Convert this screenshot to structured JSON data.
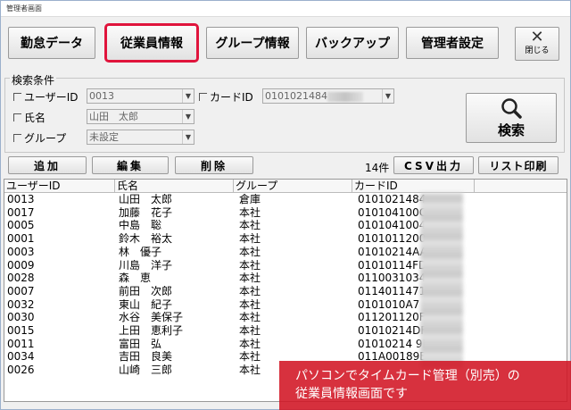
{
  "window": {
    "title": "管理者画面"
  },
  "toolbar": {
    "buttons": [
      {
        "label": "勤怠データ",
        "active": false
      },
      {
        "label": "従業員情報",
        "active": true
      },
      {
        "label": "グループ情報",
        "active": false
      },
      {
        "label": "バックアップ",
        "active": false
      },
      {
        "label": "管理者設定",
        "active": false
      }
    ],
    "close_label": "閉じる"
  },
  "search": {
    "legend": "検索条件",
    "user_id_label": "ユーザーID",
    "user_id_value": "0013",
    "card_id_label": "カードID",
    "card_id_value": "0101021484",
    "name_label": "氏名",
    "name_value": "山田　太郎",
    "group_label": "グループ",
    "group_value": "未設定",
    "search_button": "検索"
  },
  "actions": {
    "add": "追加",
    "edit": "編集",
    "delete": "削除",
    "count": "14件",
    "csv": "CSV出力",
    "print": "リスト印刷"
  },
  "table": {
    "columns": [
      "ユーザーID",
      "氏名",
      "グループ",
      "カードID"
    ],
    "rows": [
      [
        "0013",
        "山田　太郎",
        "倉庫",
        "0101021484"
      ],
      [
        "0017",
        "加藤　花子",
        "本社",
        "010104100C"
      ],
      [
        "0005",
        "中島　聡",
        "本社",
        "0101041004"
      ],
      [
        "0001",
        "鈴木　裕太",
        "本社",
        "0101011200"
      ],
      [
        "0003",
        "林　優子",
        "本社",
        "01010214AA"
      ],
      [
        "0009",
        "川島　洋子",
        "本社",
        "01010114FD"
      ],
      [
        "0028",
        "森　恵",
        "本社",
        "0110031034"
      ],
      [
        "0007",
        "前田　次郎",
        "本社",
        "0114011471"
      ],
      [
        "0032",
        "東山　紀子",
        "本社",
        "0101010A7"
      ],
      [
        "0030",
        "水谷　美保子",
        "本社",
        "011201120F"
      ],
      [
        "0015",
        "上田　恵利子",
        "本社",
        "01010214DF"
      ],
      [
        "0011",
        "富田　弘",
        "本社",
        "01010214 9E"
      ],
      [
        "0034",
        "吉田　良美",
        "本社",
        "011A00189E"
      ],
      [
        "0026",
        "山崎　三郎",
        "本社",
        ""
      ]
    ]
  },
  "caption": {
    "line1": "パソコンでタイムカード管理（別売）の",
    "line2": "従業員情報画面です"
  },
  "colors": {
    "active_border": "#e0143c",
    "caption_bg": "#d21423"
  }
}
